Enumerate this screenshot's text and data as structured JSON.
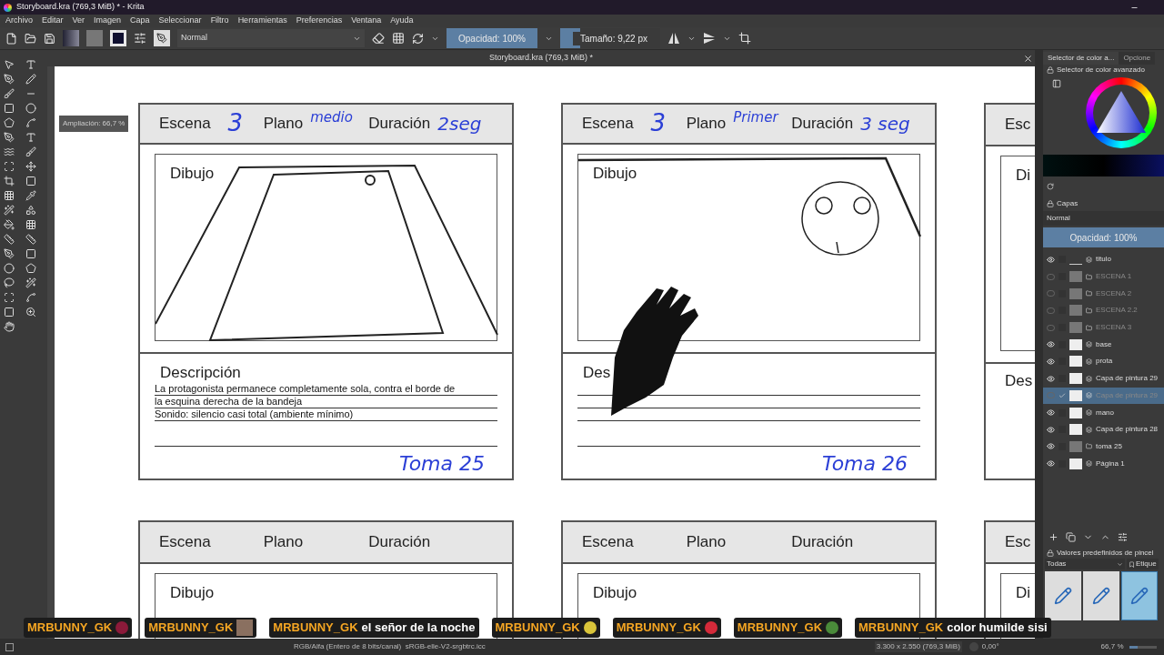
{
  "window": {
    "title": "Storyboard.kra (769,3 MiB) * - Krita"
  },
  "menu": [
    "Archivo",
    "Editar",
    "Ver",
    "Imagen",
    "Capa",
    "Seleccionar",
    "Filtro",
    "Herramientas",
    "Preferencias",
    "Ventana",
    "Ayuda"
  ],
  "toolbar": {
    "blend_mode": "Normal",
    "opacity": {
      "label": "Opacidad: 100%",
      "level": 1
    },
    "size": {
      "label": "Tamaño: 9,22 px",
      "level": 0.2
    }
  },
  "document": {
    "title": "Storyboard.kra (769,3 MiB) *",
    "zoom_hint": "Ampliación: 66,7 %"
  },
  "rows": [
    {
      "cards": [
        {
          "kind": "full",
          "scene_label": "Escena",
          "scene": "3",
          "shot_label": "Plano",
          "shot": "medio",
          "duration_label": "Duración",
          "duration": "2seg",
          "drawing_label": "Dibujo",
          "sketch": {
            "kind": "tray"
          },
          "description_label": "Descripción",
          "description": [
            "La protagonista permanece completamente sola, contra el borde de",
            "la esquina derecha de la bandeja",
            "Sonido: silencio casi total (ambiente mínimo)"
          ],
          "take": "Toma 25"
        },
        {
          "kind": "full",
          "scene_label": "Escena",
          "scene": "3",
          "shot_label": "Plano",
          "shot": "Primer",
          "duration_label": "Duración",
          "duration": "3 seg",
          "drawing_label": "Dibujo",
          "sketch": {
            "kind": "face"
          },
          "hand": true,
          "description_label": "Des",
          "take": "Toma 26"
        },
        {
          "kind": "cut",
          "scene_label": "Esc",
          "drawing_label": "Di",
          "description_label": "Des"
        }
      ]
    },
    {
      "cards": [
        {
          "kind": "full",
          "scene_label": "Escena",
          "shot_label": "Plano",
          "duration_label": "Duración",
          "drawing_label": "Dibujo"
        },
        {
          "kind": "full",
          "scene_label": "Escena",
          "shot_label": "Plano",
          "duration_label": "Duración",
          "drawing_label": "Dibujo"
        },
        {
          "kind": "cut",
          "scene_label": "Esc",
          "drawing_label": "Di"
        }
      ]
    }
  ],
  "docker": {
    "tabs": [
      {
        "label": "Selector de color a...",
        "selected": true
      },
      {
        "label": "Opcione",
        "selected": false
      }
    ],
    "color_title": "Selector de color avanzado",
    "layers_title": "Capas",
    "layers_blend": "Normal",
    "layers_opacity": {
      "label": "Opacidad:  100%",
      "level": 1
    },
    "layers": [
      {
        "name": "titulo",
        "visible": true,
        "selected": false,
        "kind": "vector"
      },
      {
        "name": "ESCENA 1",
        "visible": false,
        "selected": false,
        "kind": "group"
      },
      {
        "name": "ESCENA 2",
        "visible": false,
        "selected": false,
        "kind": "group"
      },
      {
        "name": "ESCENA 2.2",
        "visible": false,
        "selected": false,
        "kind": "group"
      },
      {
        "name": "ESCENA 3",
        "visible": false,
        "selected": false,
        "kind": "group"
      },
      {
        "name": "base",
        "visible": true,
        "selected": false,
        "kind": "paint"
      },
      {
        "name": "prota",
        "visible": true,
        "selected": false,
        "kind": "paint"
      },
      {
        "name": "Capa de pintura 29",
        "visible": true,
        "selected": false,
        "kind": "paint"
      },
      {
        "name": "Capa de pintura 29",
        "visible": false,
        "selected": true,
        "kind": "paint"
      },
      {
        "name": "mano",
        "visible": true,
        "selected": false,
        "kind": "paint"
      },
      {
        "name": "Capa de pintura 28",
        "visible": true,
        "selected": false,
        "kind": "paint"
      },
      {
        "name": "toma 25",
        "visible": true,
        "selected": false,
        "kind": "group"
      },
      {
        "name": "Página 1",
        "visible": true,
        "selected": false,
        "kind": "paint"
      }
    ],
    "presets_title": "Valores predefinidos de pincel",
    "presets_filter": "Todas",
    "presets_tag": "Etique",
    "presets": [
      {
        "selected": false
      },
      {
        "selected": false
      },
      {
        "selected": true
      }
    ]
  },
  "chat": [
    {
      "user": "MRBUNNY_GK",
      "kind": "emote",
      "color": "#8b1a3a"
    },
    {
      "user": "MRBUNNY_GK",
      "kind": "photo"
    },
    {
      "user": "MRBUNNY_GK",
      "kind": "text",
      "text": "el señor de la noche"
    },
    {
      "user": "MRBUNNY_GK",
      "kind": "emote",
      "color": "#d9c43a"
    },
    {
      "user": "MRBUNNY_GK",
      "kind": "emote",
      "color": "#d42a3a"
    },
    {
      "user": "MRBUNNY_GK",
      "kind": "emote",
      "color": "#4a8a3a"
    },
    {
      "user": "MRBUNNY_GK",
      "kind": "text",
      "text": "color humilde sisi"
    }
  ],
  "status": {
    "color_space": "RGB/Alfa (Entero de 8 bits/canal)  sRGB-elle-V2-srgbtrc.icc",
    "size": "3.300 x 2.550 (769,3 MiB)",
    "rotation": "0,00°",
    "zoom": "66,7 %",
    "zoom_slider": {
      "level": 0.3
    }
  }
}
